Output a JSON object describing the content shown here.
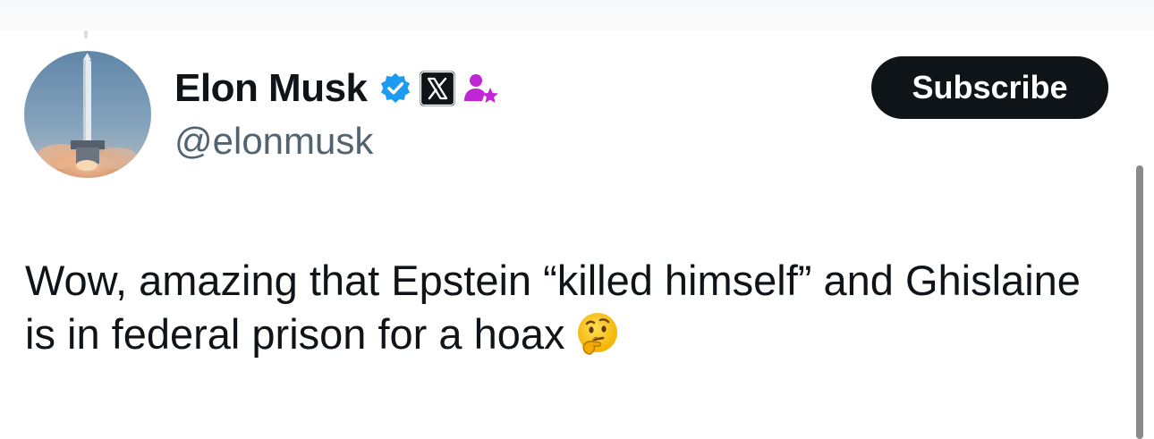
{
  "profile": {
    "display_name": "Elon Musk",
    "handle": "@elonmusk",
    "avatar_icon": "rocket-launch-avatar",
    "badges": [
      "verified-checkmark-icon",
      "x-logo-badge",
      "affiliate-person-star-icon"
    ]
  },
  "actions": {
    "subscribe_label": "Subscribe"
  },
  "tweet": {
    "text": "Wow, amazing that Epstein “killed himself” and Ghislaine is in federal prison for a hoax",
    "emoji_icon": "thinking-face-emoji"
  },
  "colors": {
    "text_primary": "#0f1419",
    "text_secondary": "#536471",
    "verified_blue": "#1d9bf0",
    "affiliate_magenta": "#c026d3",
    "subscribe_bg": "#0f1419"
  }
}
